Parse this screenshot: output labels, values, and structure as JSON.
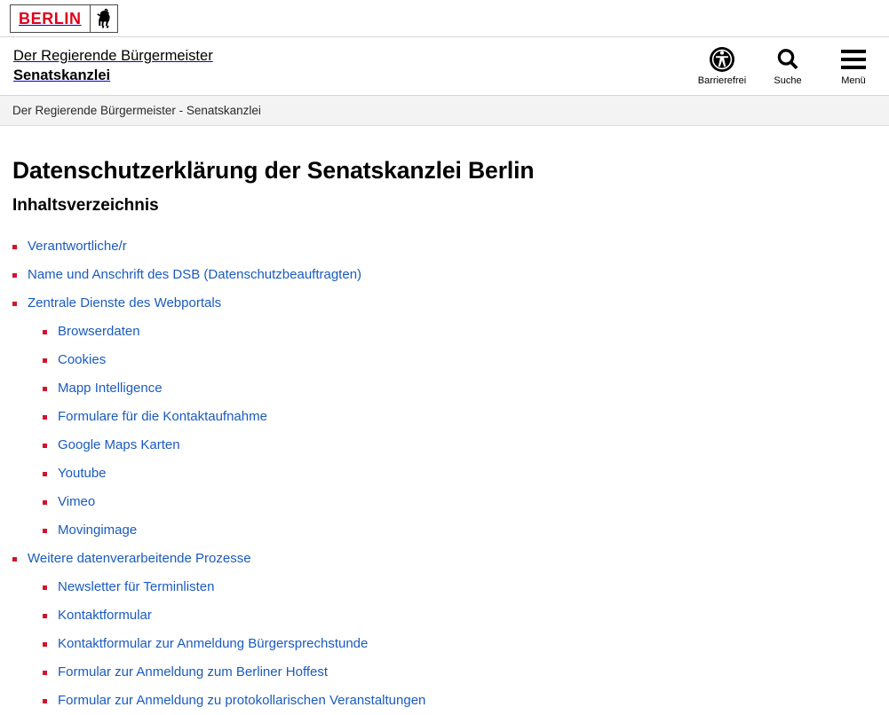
{
  "logo": {
    "word": "BERLIN",
    "bear_icon": "berlin-bear-icon"
  },
  "header": {
    "line1": "Der Regierende Bürgermeister",
    "line2": "Senatskanzlei",
    "tools": [
      {
        "label": "Barrierefrei",
        "icon": "accessibility-icon"
      },
      {
        "label": "Suche",
        "icon": "search-icon"
      },
      {
        "label": "Menü",
        "icon": "hamburger-menu-icon"
      }
    ]
  },
  "breadcrumb": {
    "text": "Der Regierende Bürgermeister - Senatskanzlei"
  },
  "main": {
    "page_title": "Datenschutzerklärung der Senatskanzlei Berlin",
    "toc_title": "Inhaltsverzeichnis",
    "toc": [
      {
        "label": "Verantwortliche/r",
        "children": []
      },
      {
        "label": "Name und Anschrift des DSB (Datenschutzbeauftragten)",
        "children": []
      },
      {
        "label": "Zentrale Dienste des Webportals",
        "children": [
          {
            "label": "Browserdaten"
          },
          {
            "label": "Cookies"
          },
          {
            "label": "Mapp Intelligence"
          },
          {
            "label": "Formulare für die Kontaktaufnahme"
          },
          {
            "label": "Google Maps Karten"
          },
          {
            "label": "Youtube"
          },
          {
            "label": "Vimeo"
          },
          {
            "label": "Movingimage"
          }
        ]
      },
      {
        "label": "Weitere datenverarbeitende Prozesse",
        "children": [
          {
            "label": "Newsletter für Terminlisten"
          },
          {
            "label": "Kontaktformular"
          },
          {
            "label": "Kontaktformular zur Anmeldung Bürgersprechstunde"
          },
          {
            "label": "Formular zur Anmeldung zum Berliner Hoffest"
          },
          {
            "label": "Formular zur Anmeldung zu protokollarischen Veranstaltungen"
          }
        ]
      }
    ]
  },
  "colors": {
    "berlin_red": "#e1001a",
    "bullet_red": "#d3132c",
    "link_blue": "#1a5bbf",
    "breadcrumb_bg": "#f3f3f3"
  }
}
